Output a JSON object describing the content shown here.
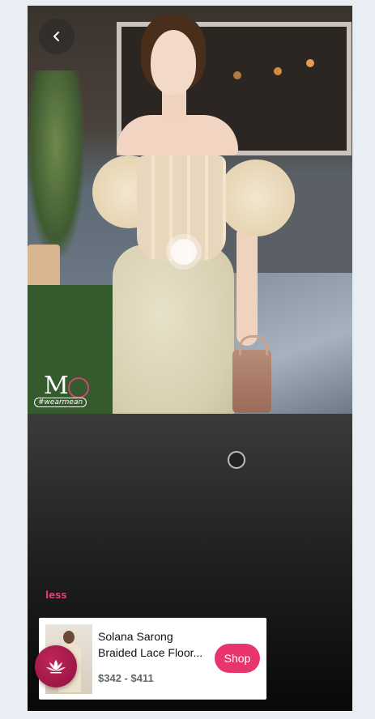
{
  "hero": {
    "watermark_tag": "#wearmean",
    "watermark_mark": "M"
  },
  "nav": {
    "back_icon": "chevron-left-icon"
  },
  "feed": {
    "less_label": "less"
  },
  "product": {
    "title_line1": "Solana Sarong",
    "title_line2": "Braided Lace Floor...",
    "price": "$342 - $411",
    "shop_label": "Shop"
  },
  "fab": {
    "icon": "lotus-icon"
  },
  "colors": {
    "accent": "#e8366c",
    "fab": "#a01a4b",
    "background": "#e9eef5"
  }
}
